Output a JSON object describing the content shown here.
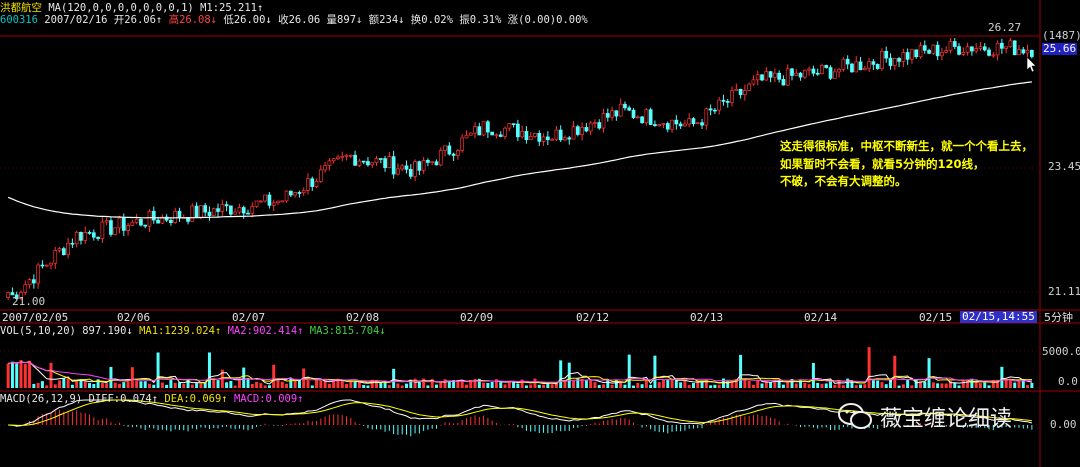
{
  "header": {
    "line1": {
      "name": "洪都航空",
      "ma_label": "MA(120,0,0,0,0,0,0,0,1)",
      "m1": "M1:25.211↑",
      "date": "2007/02/16",
      "open": "开26.06↑",
      "high": "高26.08↓",
      "low": "低26.00↓",
      "close": "收26.06",
      "volume": "量897↓",
      "amount": "额234↓",
      "turnover": "换0.02%",
      "amplitude": "振0.31%",
      "change": "涨(0.00)0.00%"
    },
    "code": "600316"
  },
  "price_axis": {
    "top_value": "26.27",
    "count_badge": "(1487)",
    "current_badge": "25.66",
    "mid_label": "23.45",
    "low_label": "21.11",
    "min_label": "21.00"
  },
  "date_axis": {
    "labels": [
      "2007/02/05",
      "02/06",
      "02/07",
      "02/08",
      "02/09",
      "02/12",
      "02/13",
      "02/14",
      "02/15"
    ],
    "cursor_label": "02/15,14:55",
    "period": "5分钟"
  },
  "volume_panel": {
    "label": "VOL(5,10,20)",
    "value": "897.190↓",
    "ma1": "MA1:1239.024↑",
    "ma2": "MA2:902.414↑",
    "ma3": "MA3:815.704↓",
    "tick_high": "5000.0",
    "tick_low": "0.0"
  },
  "macd_panel": {
    "label": "MACD(26,12,9)",
    "diff": "DIFF:0.074↑",
    "dea": "DEA:0.069↑",
    "macd": "MACD:0.009↑",
    "tick": "0.00"
  },
  "annotation": {
    "lines": [
      "这走得很标准，中枢不断新生，就一个个看上去，",
      "如果暂时不会看，就看5分钟的120线，",
      "不破，不会有大调整的。"
    ]
  },
  "watermark": {
    "text": "薇宝缠论细读",
    "icon": "wechat-icon"
  },
  "colors": {
    "up": "#ff3232",
    "down": "#54ffff",
    "ma120": "#ffffff",
    "macd_diff": "#ffffff",
    "macd_dea": "#ffff00",
    "background": "#000000",
    "grid_border": "#a00000"
  },
  "chart_data": [
    {
      "type": "candlestick",
      "title": "洪都航空 600316 5分钟",
      "period": "5分钟",
      "x": [
        "2007/02/05",
        "02/06",
        "02/07",
        "02/08",
        "02/09",
        "02/12",
        "02/13",
        "02/14",
        "02/15"
      ],
      "price_range": [
        21.0,
        26.27
      ],
      "close_trend": [
        21.0,
        22.3,
        22.6,
        22.8,
        23.0,
        23.9,
        23.6,
        24.5,
        24.3,
        24.8,
        24.5,
        25.4,
        25.6,
        25.9,
        26.1,
        26.06
      ],
      "ma120": {
        "name": "M1",
        "last_value": 25.211
      },
      "last_bar": {
        "date": "2007/02/16",
        "open": 26.06,
        "high": 26.08,
        "low": 26.0,
        "close": 26.06,
        "volume": 897
      }
    },
    {
      "type": "bar",
      "title": "VOL(5,10,20)",
      "ylim": [
        0,
        5000
      ],
      "last_value": 897.19,
      "ma": [
        1239.024,
        902.414,
        815.704
      ]
    },
    {
      "type": "line",
      "title": "MACD(26,12,9)",
      "series": [
        {
          "name": "DIFF",
          "last_value": 0.074
        },
        {
          "name": "DEA",
          "last_value": 0.069
        },
        {
          "name": "MACD",
          "last_value": 0.009
        }
      ]
    }
  ]
}
